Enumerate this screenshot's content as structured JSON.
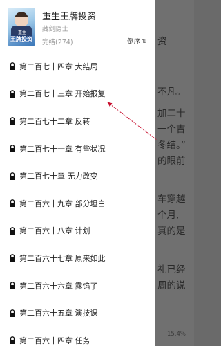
{
  "book": {
    "title": "重生王牌投资",
    "author": "藏剑隐士",
    "status": "完结(274)",
    "cover_title": "王牌投资",
    "cover_top": "重生"
  },
  "sort": {
    "label": "倒序",
    "icon": "sort-arrows-icon"
  },
  "chapters": [
    "第二百七十四章 大结局",
    "第二百七十三章 开始报复",
    "第二百七十二章 反转",
    "第二百七十一章 有些状况",
    "第二百七十章 无力改变",
    "第二百六十九章 部分坦白",
    "第二百六十八章 计划",
    "第二百六十七章 原来如此",
    "第二百六十六章 露馅了",
    "第二百六十五章 演技课",
    "第二百六十四章 任务"
  ],
  "reader": {
    "lines": [
      "资",
      "不凡。",
      "加二十",
      "一个吉",
      "冬结。”",
      "的眼前",
      "车穿越",
      "个月,",
      "真的是",
      "礼已经",
      "周的说"
    ],
    "progress": "15.4%"
  },
  "colors": {
    "annotation": "#c8102e",
    "drawer_bg": "#ffffff",
    "overlay": "#707070"
  }
}
